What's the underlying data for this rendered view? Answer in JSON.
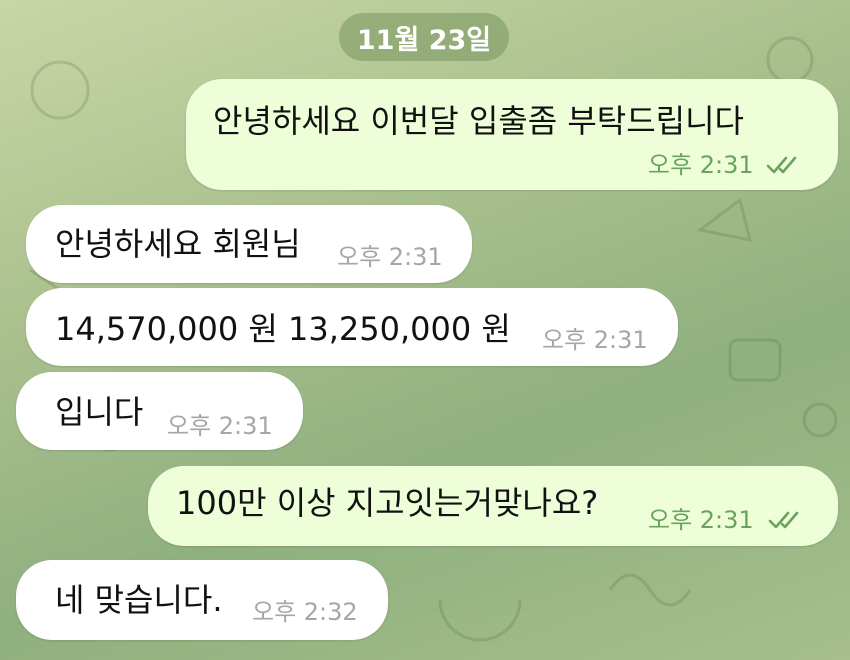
{
  "date_label": "11월 23일",
  "colors": {
    "incoming_bubble": "#ffffff",
    "outgoing_bubble": "#eefed8",
    "outgoing_time": "#6aa25e",
    "incoming_time": "#a6a6a6"
  },
  "messages": [
    {
      "direction": "outgoing",
      "text": "안녕하세요  이번달 입출좀 부탁드립니다",
      "time": "오후 2:31",
      "status": "read-double-check-icon"
    },
    {
      "direction": "incoming",
      "text": "안녕하세요 회원님",
      "time": "오후 2:31"
    },
    {
      "direction": "incoming",
      "text": "14,570,000 원  13,250,000 원",
      "time": "오후 2:31"
    },
    {
      "direction": "incoming",
      "text": "입니다",
      "time": "오후 2:31"
    },
    {
      "direction": "outgoing",
      "text": "100만 이상 지고잇는거맞나요?",
      "time": "오후 2:31",
      "status": "read-double-check-icon"
    },
    {
      "direction": "incoming",
      "text": "네 맞습니다.",
      "time": "오후 2:32"
    }
  ]
}
